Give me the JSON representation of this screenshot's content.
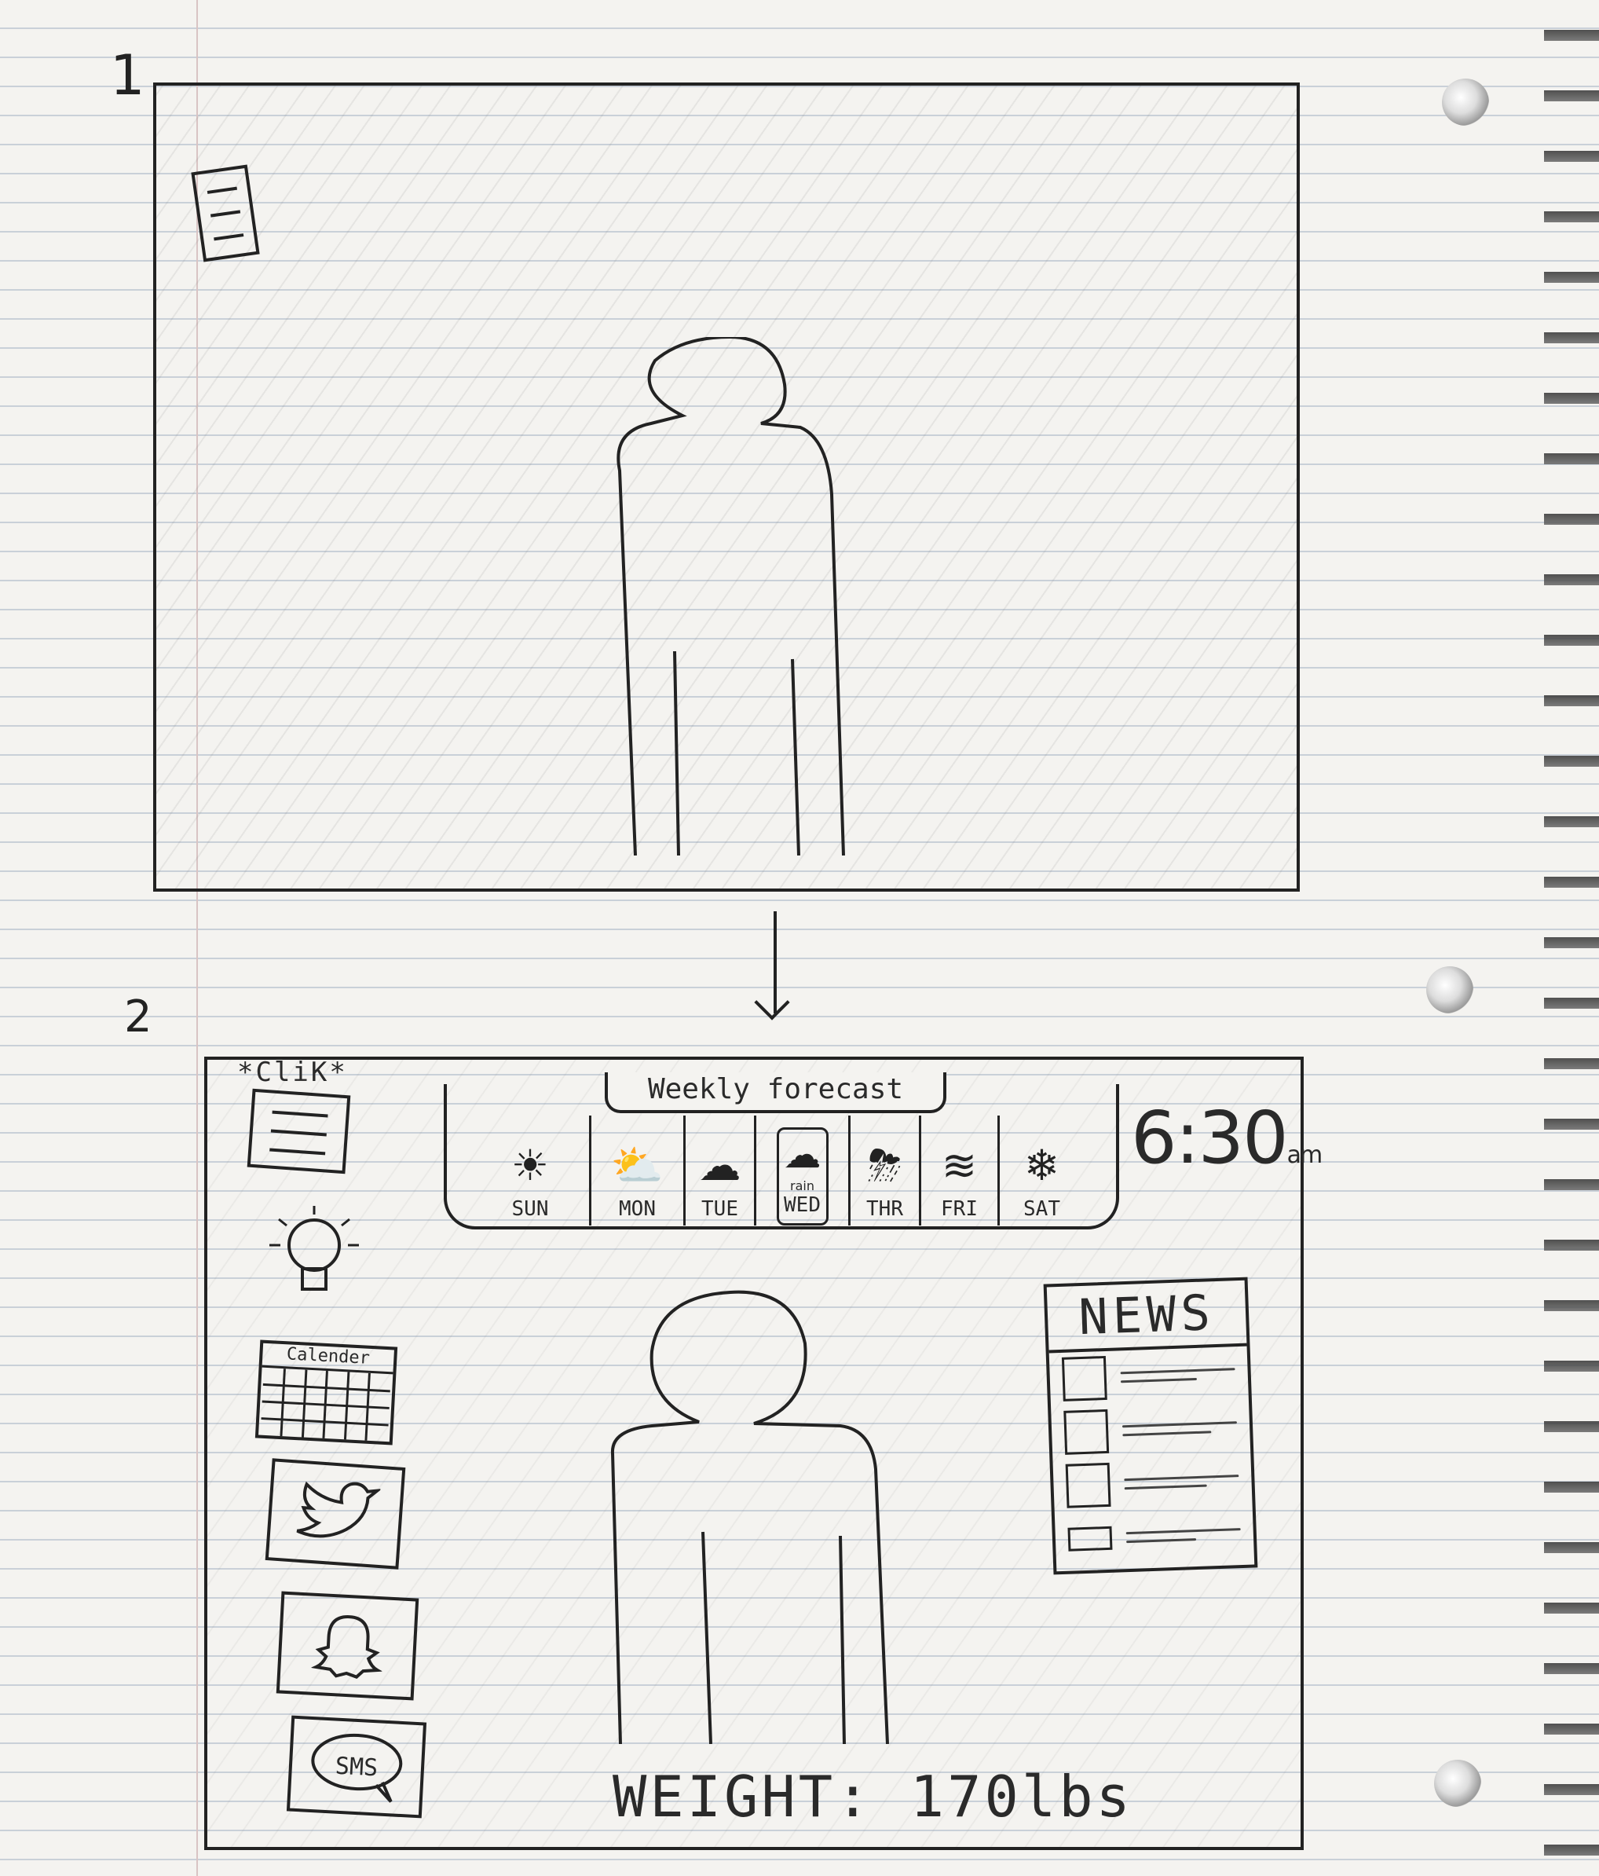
{
  "sketch": {
    "screen1_number": "1",
    "screen2_number": "2"
  },
  "screen2": {
    "click_label": "*CliK*",
    "sidebar": {
      "items": [
        {
          "name": "menu-icon"
        },
        {
          "name": "lightbulb-icon"
        },
        {
          "name": "calendar-icon",
          "label": "Calender"
        },
        {
          "name": "twitter-icon"
        },
        {
          "name": "snapchat-icon"
        },
        {
          "name": "sms-icon",
          "label": "SMS"
        }
      ]
    },
    "forecast": {
      "title": "Weekly forecast",
      "days": [
        {
          "label": "SUN",
          "icon": "sun-icon"
        },
        {
          "label": "MON",
          "icon": "partly-sunny-icon"
        },
        {
          "label": "TUE",
          "icon": "cloud-icon"
        },
        {
          "label": "WED",
          "icon": "rain-icon",
          "selected": true,
          "note": "rain"
        },
        {
          "label": "THR",
          "icon": "storm-icon"
        },
        {
          "label": "FRI",
          "icon": "wind-icon"
        },
        {
          "label": "SAT",
          "icon": "snow-icon"
        }
      ]
    },
    "clock": {
      "time": "6:30",
      "suffix": "am"
    },
    "news": {
      "title": "NEWS",
      "item_count": 4
    },
    "weight": {
      "label": "WEIGHT:",
      "value": "170lbs"
    }
  }
}
